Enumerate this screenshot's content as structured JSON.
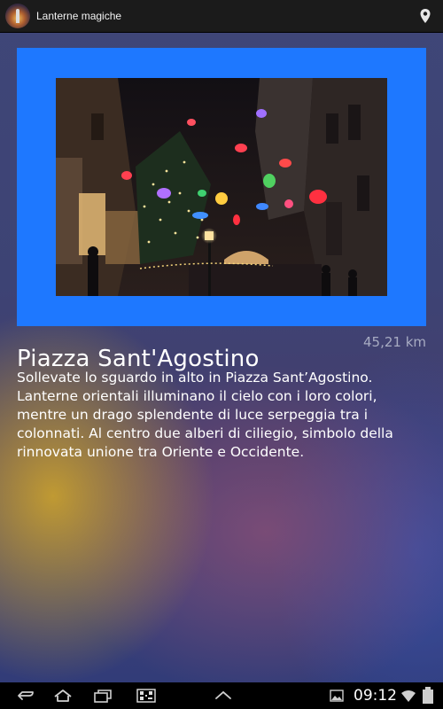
{
  "app": {
    "title": "Lanterne magiche"
  },
  "place": {
    "name": "Piazza Sant'Agostino",
    "distance": "45,21 km",
    "description": "Sollevate lo sguardo in alto in Piazza Sant’Agostino. Lanterne orientali illuminano il cielo con i loro colori, mentre un drago splendente di luce serpeggia tra i colonnati. Al centro due alberi di ciliegio, simbolo della rinnovata unione tra Oriente e Occidente."
  },
  "status_bar": {
    "time": "09:12"
  },
  "colors": {
    "frame": "#1e78ff",
    "action_bar": "#1b1b1b",
    "distance": "#a7abc2"
  },
  "icons": [
    "app-icon",
    "map-pin-icon",
    "back-icon",
    "home-icon",
    "recent-apps-icon",
    "qr-scan-icon",
    "up-arrow-icon",
    "gallery-icon",
    "wifi-icon",
    "battery-icon"
  ]
}
